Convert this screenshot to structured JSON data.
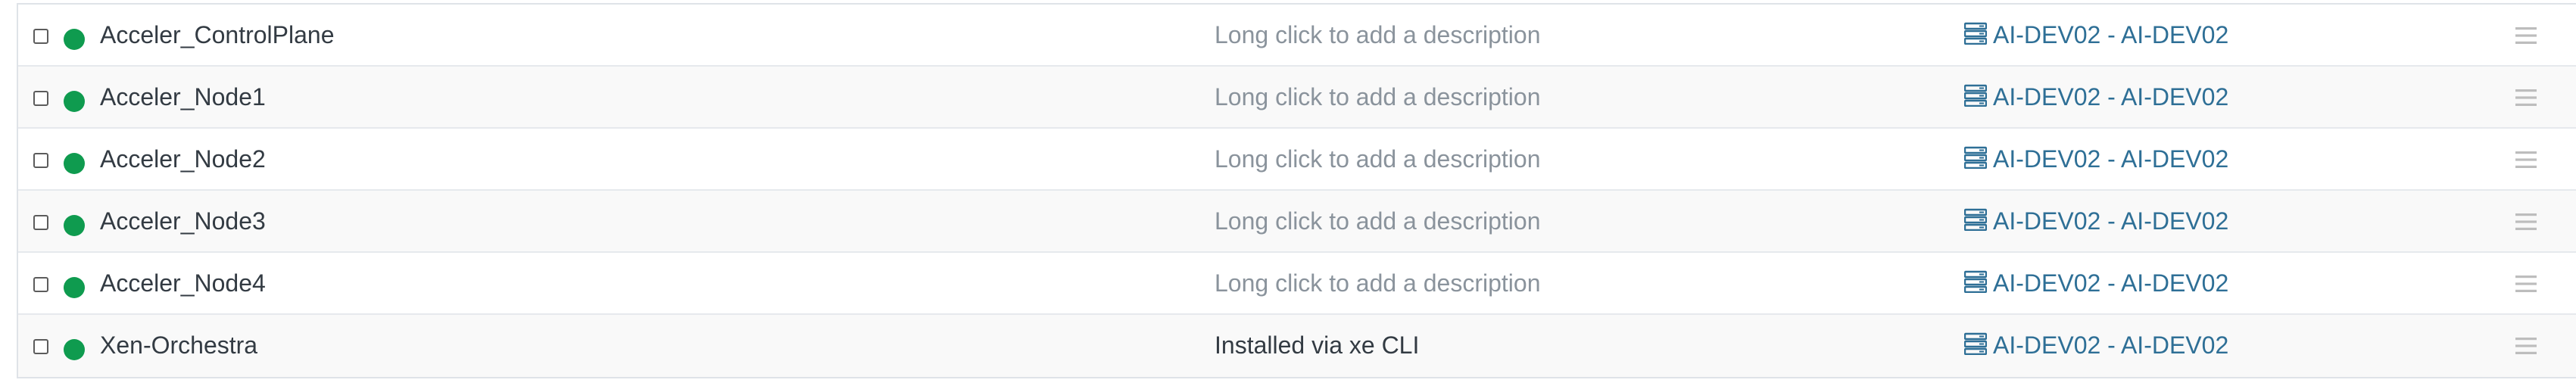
{
  "colors": {
    "status_running": "#0f9b4f",
    "host_link": "#2e6f96",
    "placeholder_text": "#8a939c",
    "text": "#333b43"
  },
  "icons": {
    "status": "status-running-icon",
    "host": "server-icon",
    "handle": "drag-handle-icon"
  },
  "vms": [
    {
      "name": "Acceler_ControlPlane",
      "description": "Long click to add a description",
      "description_is_placeholder": true,
      "host": "AI-DEV02 - AI-DEV02"
    },
    {
      "name": "Acceler_Node1",
      "description": "Long click to add a description",
      "description_is_placeholder": true,
      "host": "AI-DEV02 - AI-DEV02"
    },
    {
      "name": "Acceler_Node2",
      "description": "Long click to add a description",
      "description_is_placeholder": true,
      "host": "AI-DEV02 - AI-DEV02"
    },
    {
      "name": "Acceler_Node3",
      "description": "Long click to add a description",
      "description_is_placeholder": true,
      "host": "AI-DEV02 - AI-DEV02"
    },
    {
      "name": "Acceler_Node4",
      "description": "Long click to add a description",
      "description_is_placeholder": true,
      "host": "AI-DEV02 - AI-DEV02"
    },
    {
      "name": "Xen-Orchestra",
      "description": "Installed via xe CLI",
      "description_is_placeholder": false,
      "host": "AI-DEV02 - AI-DEV02"
    }
  ]
}
